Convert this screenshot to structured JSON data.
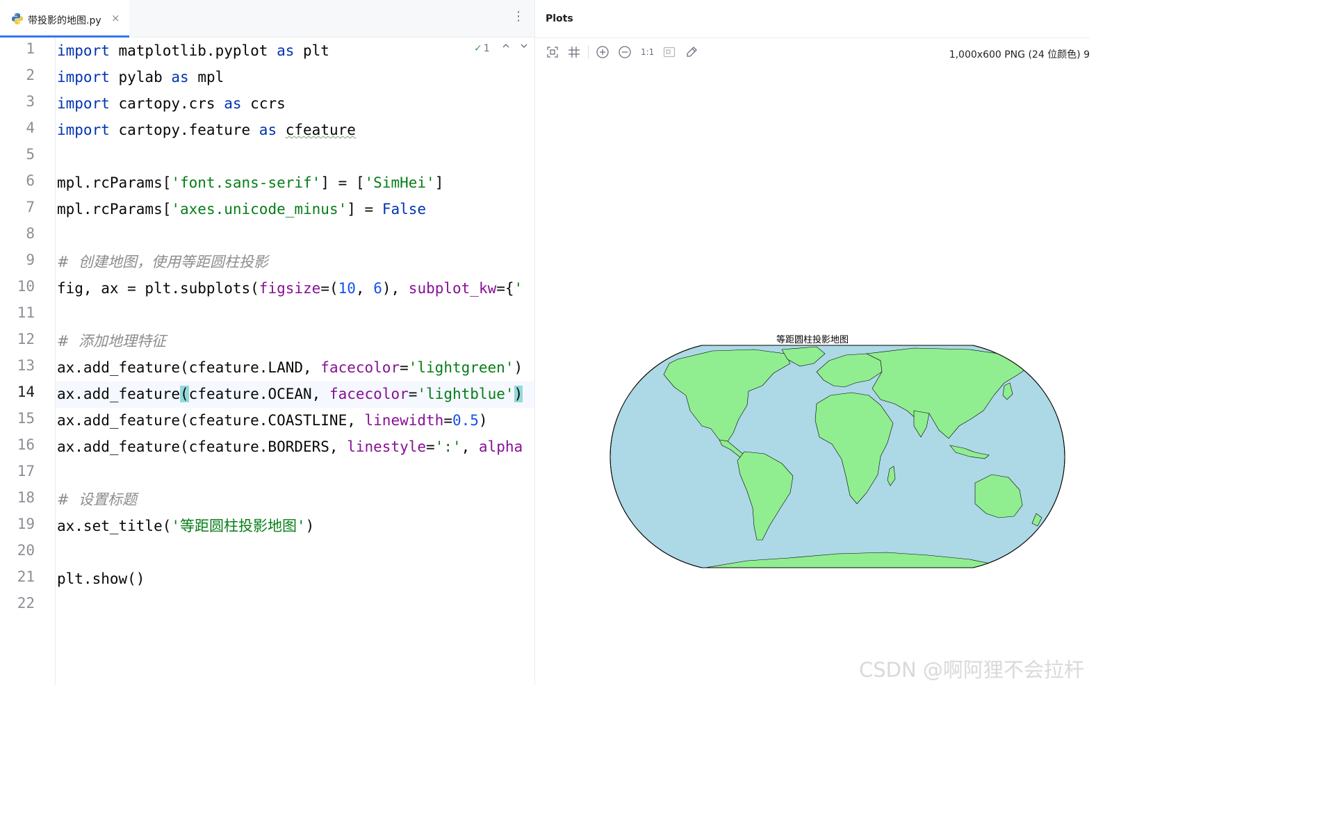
{
  "editor": {
    "tab": {
      "filename": "带投影的地图.py",
      "close_glyph": "×",
      "icon": "python-file-icon"
    },
    "tab_menu_glyph": "⋮",
    "inspection": {
      "check_glyph": "✓",
      "count": "1",
      "up_glyph": "^",
      "down_glyph": "v"
    },
    "current_line": 14,
    "line_numbers": [
      "1",
      "2",
      "3",
      "4",
      "5",
      "6",
      "7",
      "8",
      "9",
      "10",
      "11",
      "12",
      "13",
      "14",
      "15",
      "16",
      "17",
      "18",
      "19",
      "20",
      "21",
      "22"
    ],
    "lines": [
      [
        {
          "t": "import",
          "c": "kw"
        },
        {
          "t": " matplotlib.pyplot "
        },
        {
          "t": "as",
          "c": "kw"
        },
        {
          "t": " plt"
        }
      ],
      [
        {
          "t": "import",
          "c": "kw"
        },
        {
          "t": " pylab "
        },
        {
          "t": "as",
          "c": "kw"
        },
        {
          "t": " mpl"
        }
      ],
      [
        {
          "t": "import",
          "c": "kw"
        },
        {
          "t": " cartopy.crs "
        },
        {
          "t": "as",
          "c": "kw"
        },
        {
          "t": " ccrs"
        }
      ],
      [
        {
          "t": "import",
          "c": "kw"
        },
        {
          "t": " cartopy.feature "
        },
        {
          "t": "as",
          "c": "kw"
        },
        {
          "t": " "
        },
        {
          "t": "cfeature",
          "c": "wavy"
        }
      ],
      [],
      [
        {
          "t": "mpl.rcParams["
        },
        {
          "t": "'font.sans-serif'",
          "c": "str"
        },
        {
          "t": "] = ["
        },
        {
          "t": "'SimHei'",
          "c": "str"
        },
        {
          "t": "]"
        }
      ],
      [
        {
          "t": "mpl.rcParams["
        },
        {
          "t": "'axes.unicode_minus'",
          "c": "str"
        },
        {
          "t": "] = "
        },
        {
          "t": "False",
          "c": "kw"
        }
      ],
      [],
      [
        {
          "t": "#  创建地图，使用等距圆柱投影",
          "c": "cmt"
        }
      ],
      [
        {
          "t": "fig, ax = plt.subplots("
        },
        {
          "t": "figsize",
          "c": "param"
        },
        {
          "t": "=("
        },
        {
          "t": "10",
          "c": "num"
        },
        {
          "t": ", "
        },
        {
          "t": "6",
          "c": "num"
        },
        {
          "t": "), "
        },
        {
          "t": "subplot_kw",
          "c": "param"
        },
        {
          "t": "={"
        },
        {
          "t": "'",
          "c": "str"
        }
      ],
      [],
      [
        {
          "t": "#  添加地理特征",
          "c": "cmt"
        }
      ],
      [
        {
          "t": "ax.add_feature(cfeature.LAND, "
        },
        {
          "t": "facecolor",
          "c": "param"
        },
        {
          "t": "="
        },
        {
          "t": "'lightgreen'",
          "c": "str"
        },
        {
          "t": ")"
        }
      ],
      [
        {
          "t": "ax.add_feature"
        },
        {
          "t": "(",
          "c": "brk"
        },
        {
          "t": "cfeature.OCEAN, "
        },
        {
          "t": "facecolor",
          "c": "param"
        },
        {
          "t": "="
        },
        {
          "t": "'lightblue'",
          "c": "str"
        },
        {
          "t": ")",
          "c": "brk"
        }
      ],
      [
        {
          "t": "ax.add_feature(cfeature.COASTLINE, "
        },
        {
          "t": "linewidth",
          "c": "param"
        },
        {
          "t": "="
        },
        {
          "t": "0.5",
          "c": "num"
        },
        {
          "t": ")"
        }
      ],
      [
        {
          "t": "ax.add_feature(cfeature.BORDERS, "
        },
        {
          "t": "linestyle",
          "c": "param"
        },
        {
          "t": "="
        },
        {
          "t": "':'",
          "c": "str"
        },
        {
          "t": ", "
        },
        {
          "t": "alpha",
          "c": "param"
        }
      ],
      [],
      [
        {
          "t": "#  设置标题",
          "c": "cmt"
        }
      ],
      [
        {
          "t": "ax.set_title("
        },
        {
          "t": "'等距圆柱投影地图'",
          "c": "str"
        },
        {
          "t": ")"
        }
      ],
      [],
      [
        {
          "t": "plt.show()"
        }
      ],
      []
    ]
  },
  "plots": {
    "title": "Plots",
    "toolbar": {
      "zoom_reset_label": "1:1",
      "icons": [
        "fit-screen-icon",
        "grid-icon",
        "zoom-in-icon",
        "zoom-out-icon",
        "actual-size-icon",
        "fit-zoom-icon",
        "color-picker-icon"
      ]
    },
    "image_info": "1,000x600 PNG (24 位颜色) 9",
    "figure": {
      "title": "等距圆柱投影地图",
      "ocean_color": "#add8e6",
      "land_color": "#90ee90"
    }
  },
  "watermark": "CSDN @啊阿狸不会拉杆",
  "colors": {
    "accent": "#3574f0",
    "keyword": "#0033b3",
    "string": "#067d17",
    "number": "#1750eb",
    "param": "#871094",
    "comment": "#8c8c8c"
  }
}
